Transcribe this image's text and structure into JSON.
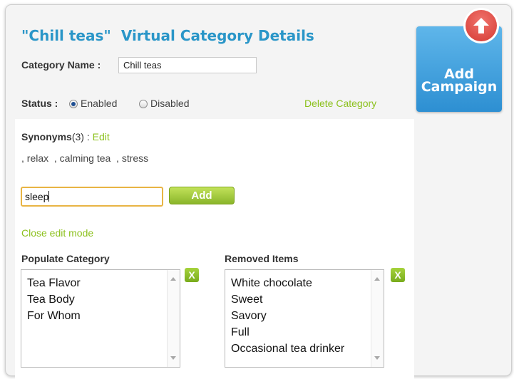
{
  "header": {
    "title_quoted": "\"Chill teas\"",
    "title_rest": "Virtual Category Details"
  },
  "category": {
    "name_label": "Category Name :",
    "name_value": "Chill teas"
  },
  "status": {
    "label": "Status :",
    "enabled_label": "Enabled",
    "disabled_label": "Disabled",
    "selected": "Enabled"
  },
  "delete_link": "Delete Category",
  "synonyms": {
    "label": "Synonyms",
    "count": "(3)",
    "separator": " : ",
    "edit_link": "Edit",
    "list": ", relax  , calming tea  , stress",
    "input_value": "sleep",
    "add_label": "Add"
  },
  "close_edit_link": "Close edit mode",
  "populate": {
    "heading": "Populate Category",
    "items": [
      "Tea Flavor",
      "Tea Body",
      "For Whom"
    ],
    "remove_label": "X"
  },
  "removed": {
    "heading": "Removed Items",
    "items": [
      "White chocolate",
      "Sweet",
      "Savory",
      "Full",
      "Occasional tea drinker"
    ],
    "remove_label": "X"
  },
  "campaign": {
    "line1": "Add",
    "line2": "Campaign",
    "icon": "up-arrow-icon"
  },
  "colors": {
    "title_blue": "#2a96c8",
    "link_green": "#8cc11d",
    "campaign_blue": "#3a9ddc",
    "up_circle_red": "#e0453e"
  }
}
